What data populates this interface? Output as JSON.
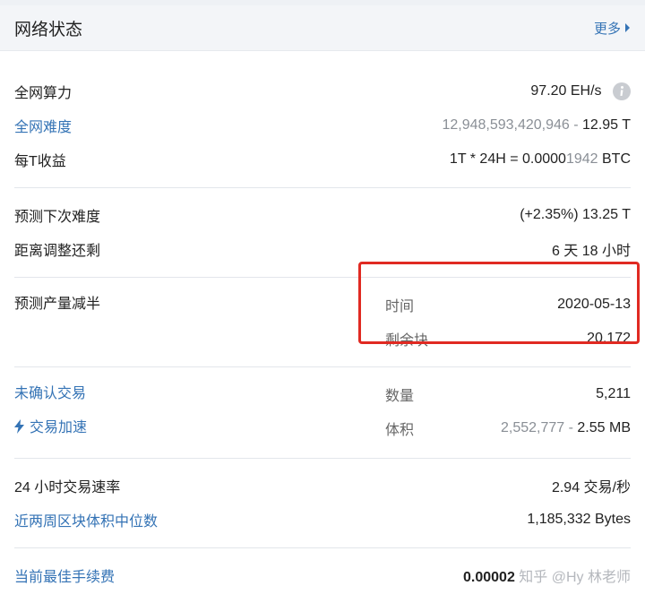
{
  "header": {
    "title": "网络状态",
    "more_label": "更多"
  },
  "network": {
    "hashrate": {
      "label": "全网算力",
      "value": "97.20 EH/s"
    },
    "difficulty": {
      "label": "全网难度",
      "value_raw": "12,948,593,420,946",
      "separator": " - ",
      "value_short": "12.95 T"
    },
    "earnings": {
      "label": "每T收益",
      "value_prefix": "1T * 24H = 0.0000",
      "value_highlight": "1942",
      "value_unit": " BTC"
    }
  },
  "adjustment": {
    "next_difficulty": {
      "label": "预测下次难度",
      "value": "(+2.35%) 13.25 T"
    },
    "remaining": {
      "label": "距离调整还剩",
      "value": "6 天 18 小时"
    }
  },
  "halving": {
    "label": "预测产量减半",
    "time": {
      "label": "时间",
      "value": "2020-05-13"
    },
    "blocks": {
      "label": "剩余块",
      "value": "20,172"
    }
  },
  "mempool": {
    "unconfirmed": {
      "label": "未确认交易",
      "sublabel": "数量",
      "value": "5,211"
    },
    "accelerate": {
      "label": "交易加速",
      "sublabel": "体积",
      "value_raw": "2,552,777",
      "separator": " - ",
      "value_short": "2.55 MB"
    }
  },
  "stats": {
    "tx_rate": {
      "label": "24 小时交易速率",
      "value": "2.94 交易/秒"
    },
    "median_size": {
      "label": "近两周区块体积中位数",
      "value": "1,185,332 Bytes"
    }
  },
  "fees": {
    "label": "当前最佳手续费",
    "value": "0.00002",
    "value_suffix": " 知乎 @Hy 林老师"
  },
  "colors": {
    "link": "#3473b5",
    "highlight_box": "#e02a22",
    "muted": "#8a8f96"
  }
}
